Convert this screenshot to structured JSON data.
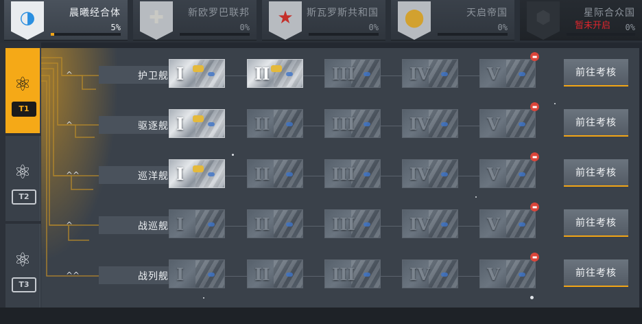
{
  "factions": [
    {
      "name": "晨曦经合体",
      "percent": "5%",
      "progress": 0.05,
      "emblem_icon": "blue-crescent-emblem-icon",
      "state": "active",
      "color": "#2b8fe0"
    },
    {
      "name": "新欧罗巴联邦",
      "percent": "0%",
      "progress": 0,
      "emblem_icon": "black-cross-emblem-icon",
      "state": "normal",
      "color": "#c9c9c4"
    },
    {
      "name": "斯瓦罗斯共和国",
      "percent": "0%",
      "progress": 0,
      "emblem_icon": "red-star-emblem-icon",
      "state": "normal",
      "color": "#c42f2a"
    },
    {
      "name": "天启帝国",
      "percent": "0%",
      "progress": 0,
      "emblem_icon": "gold-rings-emblem-icon",
      "state": "normal",
      "color": "#d2a12f"
    },
    {
      "name": "星际合众国",
      "percent": "0%",
      "progress": 0,
      "emblem_icon": "dark-hexagon-emblem-icon",
      "state": "locked",
      "color": "#3a3f45",
      "lock_text": "暂未开启"
    }
  ],
  "tiers": [
    {
      "label": "T1",
      "icon": "atom-icon",
      "active": true
    },
    {
      "label": "T2",
      "icon": "atom-icon",
      "active": false
    },
    {
      "label": "T3",
      "icon": "atom-icon",
      "active": false
    }
  ],
  "rows": [
    {
      "name": "护卫舰",
      "chevron": "^",
      "unlocked": [
        true,
        true,
        false,
        false,
        false
      ],
      "button": "前往考核"
    },
    {
      "name": "驱逐舰",
      "chevron": "^",
      "unlocked": [
        true,
        false,
        false,
        false,
        false
      ],
      "button": "前往考核"
    },
    {
      "name": "巡洋舰",
      "chevron": "^^",
      "unlocked": [
        true,
        false,
        false,
        false,
        false
      ],
      "button": "前往考核"
    },
    {
      "name": "战巡舰",
      "chevron": "^",
      "unlocked": [
        false,
        false,
        false,
        false,
        false
      ],
      "button": "前往考核"
    },
    {
      "name": "战列舰",
      "chevron": "^^",
      "unlocked": [
        false,
        false,
        false,
        false,
        false
      ],
      "button": "前往考核"
    }
  ],
  "tier_numerals": [
    "I",
    "II",
    "III",
    "IV",
    "V"
  ],
  "colors": {
    "accent": "#f3a515",
    "lock_badge": "#d9453a",
    "lock_text": "#e0252c",
    "panel": "#3a414a"
  }
}
